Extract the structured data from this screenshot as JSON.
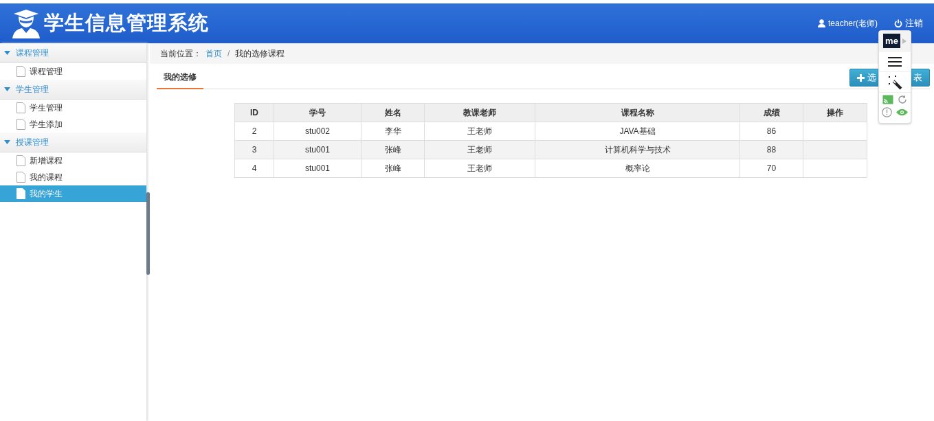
{
  "header": {
    "title": "学生信息管理系统",
    "user": "teacher(老师)",
    "logout": "注销"
  },
  "sidebar": {
    "groups": [
      {
        "label": "课程管理",
        "expanded": true,
        "items": [
          {
            "label": "课程管理",
            "selected": false
          }
        ]
      },
      {
        "label": "学生管理",
        "expanded": true,
        "items": [
          {
            "label": "学生管理",
            "selected": false
          },
          {
            "label": "学生添加",
            "selected": false
          }
        ]
      },
      {
        "label": "授课管理",
        "expanded": true,
        "items": [
          {
            "label": "新增课程",
            "selected": false
          },
          {
            "label": "我的课程",
            "selected": false
          },
          {
            "label": "我的学生",
            "selected": true
          }
        ]
      }
    ]
  },
  "breadcrumb": {
    "prefix": "当前位置：",
    "separator": "/",
    "items": [
      "首页",
      "我的选修课程"
    ]
  },
  "tabs": [
    {
      "label": "我的选修",
      "selected": true
    }
  ],
  "action_button": {
    "label_start": "选",
    "label_end": "表"
  },
  "table": {
    "columns": [
      "ID",
      "学号",
      "姓名",
      "教课老师",
      "课程名称",
      "成绩",
      "操作"
    ],
    "rows": [
      [
        "2",
        "stu002",
        "李华",
        "王老师",
        "JAVA基础",
        "86",
        ""
      ],
      [
        "3",
        "stu001",
        "张峰",
        "王老师",
        "计算机科学与技术",
        "88",
        ""
      ],
      [
        "4",
        "stu001",
        "张峰",
        "王老师",
        "概率论",
        "70",
        ""
      ]
    ]
  },
  "extension_popup": {
    "logo": "me"
  }
}
